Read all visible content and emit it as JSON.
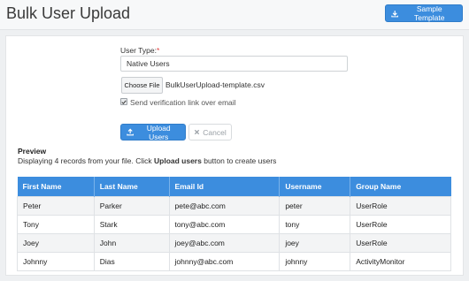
{
  "header": {
    "title": "Bulk User Upload",
    "sample_template_label": "Sample Template"
  },
  "form": {
    "user_type_label": "User Type:",
    "required_marker": "*",
    "user_type_value": "Native Users",
    "choose_file_label": "Choose File",
    "file_name": "BulkUserUpload-template.csv",
    "send_verification_label": "Send verification link over email",
    "send_verification_checked": true,
    "upload_label": "Upload Users",
    "cancel_label": "Cancel"
  },
  "preview": {
    "title": "Preview",
    "desc_prefix": "Displaying 4 records from your file. Click ",
    "desc_bold": "Upload users",
    "desc_suffix": " button to create users"
  },
  "table": {
    "headers": [
      "First Name",
      "Last Name",
      "Email Id",
      "Username",
      "Group Name"
    ],
    "rows": [
      [
        "Peter",
        "Parker",
        "pete@abc.com",
        "peter",
        "UserRole"
      ],
      [
        "Tony",
        "Stark",
        "tony@abc.com",
        "tony",
        "UserRole"
      ],
      [
        "Joey",
        "John",
        "joey@abc.com",
        "joey",
        "UserRole"
      ],
      [
        "Johnny",
        "Dias",
        "johnny@abc.com",
        "johnny",
        "ActivityMonitor"
      ]
    ]
  },
  "colors": {
    "accent": "#3c8dde",
    "required": "#e23c3c"
  }
}
